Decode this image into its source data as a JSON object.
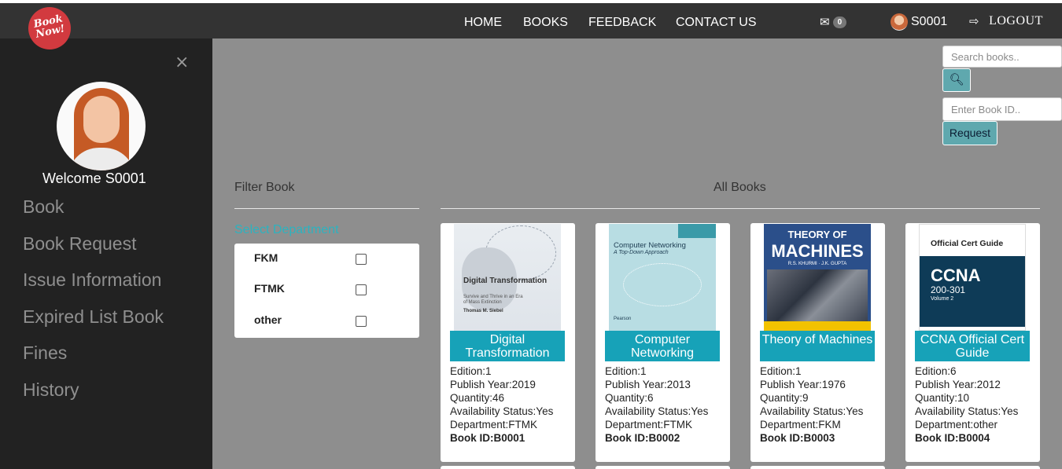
{
  "app": {
    "logo_line1": "Book",
    "logo_line2": "Now!"
  },
  "nav": {
    "items": [
      "HOME",
      "BOOKS",
      "FEEDBACK",
      "CONTACT US"
    ],
    "mail_count": "0",
    "user": "S0001",
    "logout": "LOGOUT"
  },
  "sidebar": {
    "close": "×",
    "welcome": "Welcome S0001",
    "items": [
      "Book",
      "Book Request",
      "Issue Information",
      "Expired List Book",
      "Fines",
      "History"
    ]
  },
  "search": {
    "placeholder": "Search books..",
    "book_id_placeholder": "Enter Book ID..",
    "request_label": "Request"
  },
  "filter": {
    "title": "Filter Book",
    "department_label": "Select Department",
    "departments": [
      "FKM",
      "FTMK",
      "other"
    ]
  },
  "catalog": {
    "title": "All Books",
    "books": [
      {
        "title": "Digital Transformation",
        "edition": "Edition:1",
        "year": "Publish Year:2019",
        "quantity": "Quantity:46",
        "availability": "Availability Status:Yes",
        "department": "Department:FTMK",
        "book_id": "Book ID:B0001",
        "cover": {
          "title": "Digital Transformation",
          "subtitle": "Survive and Thrive in an Era of Mass Extinction",
          "author": "Thomas M. Siebel"
        }
      },
      {
        "title": "Computer Networking",
        "edition": "Edition:1",
        "year": "Publish Year:2013",
        "quantity": "Quantity:6",
        "availability": "Availability Status:Yes",
        "department": "Department:FTMK",
        "book_id": "Book ID:B0002",
        "cover": {
          "title": "Computer Networking",
          "subtitle": "A Top-Down Approach",
          "publisher": "Pearson"
        }
      },
      {
        "title": "Theory of Machines",
        "edition": "Edition:1",
        "year": "Publish Year:1976",
        "quantity": "Quantity:9",
        "availability": "Availability Status:Yes",
        "department": "Department:FKM",
        "book_id": "Book ID:B0003",
        "cover": {
          "line1": "THEORY OF",
          "line2": "MACHINES",
          "author": "R.S. KHURMI · J.K. GUPTA"
        }
      },
      {
        "title": "CCNA Official Cert Guide",
        "edition": "Edition:6",
        "year": "Publish Year:2012",
        "quantity": "Quantity:10",
        "availability": "Availability Status:Yes",
        "department": "Department:other",
        "book_id": "Book ID:B0004",
        "cover": {
          "title": "Official Cert Guide",
          "big": "CCNA",
          "code": "200-301",
          "volume": "Volume 2"
        }
      }
    ]
  },
  "colors": {
    "topbar": "#333333",
    "sidebar": "#222222",
    "main_bg": "#8e8e8e",
    "accent": "#17a2b8",
    "button": "#5fa8ae",
    "logo": "#d23a3f"
  },
  "icons": [
    "envelope-icon",
    "search-icon",
    "logout-icon",
    "close-icon"
  ]
}
